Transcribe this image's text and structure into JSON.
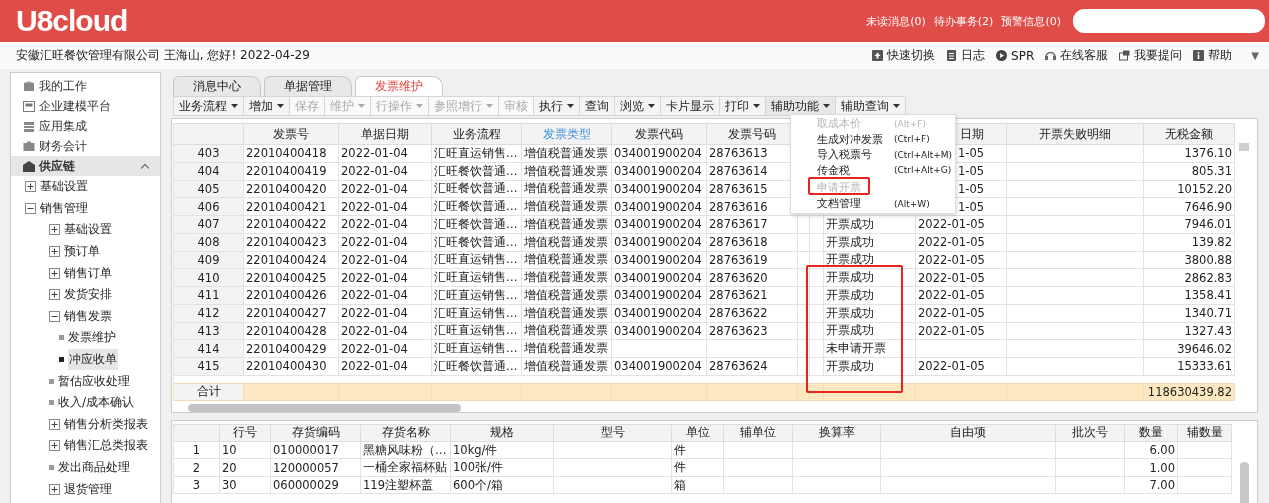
{
  "header": {
    "logo": "U8cloud",
    "links": [
      "未读消息(0)",
      "待办事务(2)",
      "预警信息(0)"
    ]
  },
  "infobar": {
    "greeting": "安徽汇旺餐饮管理有限公司 王海山, 您好! 2022-04-29",
    "tools": [
      "快速切换",
      "日志",
      "SPR",
      "在线客服",
      "我要提问",
      "帮助"
    ],
    "more": "▼"
  },
  "sidebar": {
    "items": [
      {
        "label": "我的工作",
        "kind": "module",
        "selected": false,
        "expanded": false
      },
      {
        "label": "企业建模平台",
        "kind": "module",
        "selected": false,
        "expanded": false
      },
      {
        "label": "应用集成",
        "kind": "module",
        "selected": false,
        "expanded": false
      },
      {
        "label": "财务会计",
        "kind": "module",
        "selected": false,
        "expanded": false
      },
      {
        "label": "供应链",
        "kind": "module",
        "selected": true,
        "expanded": true,
        "children": [
          {
            "label": "基础设置",
            "kind": "folder",
            "selected": false,
            "expanded": false
          },
          {
            "label": "销售管理",
            "kind": "folder",
            "selected": false,
            "expanded": true,
            "children": [
              {
                "label": "基础设置",
                "kind": "folder",
                "selected": false,
                "expanded": false
              },
              {
                "label": "预订单",
                "kind": "folder",
                "selected": false,
                "expanded": false
              },
              {
                "label": "销售订单",
                "kind": "folder",
                "selected": false,
                "expanded": false
              },
              {
                "label": "发货安排",
                "kind": "folder",
                "selected": false,
                "expanded": false
              },
              {
                "label": "销售发票",
                "kind": "folder",
                "selected": false,
                "expanded": true,
                "children": [
                  {
                    "label": "发票维护",
                    "kind": "leaf",
                    "selected": false
                  },
                  {
                    "label": "冲应收单",
                    "kind": "leaf",
                    "selected": true
                  }
                ]
              },
              {
                "label": "暂估应收处理",
                "kind": "leaf",
                "selected": false
              },
              {
                "label": "收入/成本确认",
                "kind": "leaf",
                "selected": false
              },
              {
                "label": "销售分析类报表",
                "kind": "folder",
                "selected": false,
                "expanded": false
              },
              {
                "label": "销售汇总类报表",
                "kind": "folder",
                "selected": false,
                "expanded": false
              },
              {
                "label": "发出商品处理",
                "kind": "leaf",
                "selected": false
              },
              {
                "label": "退货管理",
                "kind": "folder",
                "selected": false,
                "expanded": false
              }
            ]
          }
        ]
      }
    ]
  },
  "tabs": [
    {
      "label": "消息中心",
      "selected": false
    },
    {
      "label": "单据管理",
      "selected": false
    },
    {
      "label": "发票维护",
      "selected": true
    }
  ],
  "toolbar": [
    {
      "label": "业务流程",
      "dropdown": true,
      "disabled": false,
      "open": false
    },
    {
      "label": "增加",
      "dropdown": true,
      "disabled": false,
      "open": false
    },
    {
      "label": "保存",
      "dropdown": false,
      "disabled": true,
      "open": false
    },
    {
      "label": "维护",
      "dropdown": true,
      "disabled": true,
      "open": false
    },
    {
      "label": "行操作",
      "dropdown": true,
      "disabled": true,
      "open": false
    },
    {
      "label": "参照增行",
      "dropdown": true,
      "disabled": true,
      "open": false
    },
    {
      "label": "审核",
      "dropdown": false,
      "disabled": true,
      "open": false
    },
    {
      "label": "执行",
      "dropdown": true,
      "disabled": false,
      "open": false
    },
    {
      "label": "查询",
      "dropdown": false,
      "disabled": false,
      "open": false
    },
    {
      "label": "浏览",
      "dropdown": true,
      "disabled": false,
      "open": false
    },
    {
      "label": "卡片显示",
      "dropdown": false,
      "disabled": false,
      "open": false
    },
    {
      "label": "打印",
      "dropdown": true,
      "disabled": false,
      "open": false
    },
    {
      "label": "辅助功能",
      "dropdown": true,
      "disabled": false,
      "open": true
    },
    {
      "label": "辅助查询",
      "dropdown": true,
      "disabled": false,
      "open": false
    }
  ],
  "dropdown_menu": {
    "items": [
      {
        "label": "取成本价",
        "shortcut": "(Alt+F)",
        "disabled": true
      },
      {
        "label": "生成对冲发票",
        "shortcut": "(Ctrl+F)",
        "disabled": false
      },
      {
        "label": "导入税票号",
        "shortcut": "(Ctrl+Alt+M)",
        "disabled": false
      },
      {
        "label": "传金税",
        "shortcut": "(Ctrl+Alt+G)",
        "disabled": false
      },
      {
        "label": "申请开票",
        "disabled": true
      },
      {
        "label": "文档管理",
        "shortcut": "(Alt+W)",
        "disabled": false
      }
    ]
  },
  "invoice_table": {
    "columns": [
      null,
      {
        "label": "发票号",
        "highlighted": false
      },
      {
        "label": "单据日期",
        "highlighted": false
      },
      {
        "label": "业务流程",
        "highlighted": false
      },
      {
        "label": "发票类型",
        "highlighted": true
      },
      {
        "label": "发票代码",
        "highlighted": false
      },
      {
        "label": "发票号码",
        "highlighted": false
      },
      null,
      null,
      null,
      {
        "label": "日期",
        "highlighted": false
      },
      {
        "label": "开票失败明细",
        "highlighted": false
      },
      {
        "label": "无税金额",
        "highlighted": false
      }
    ],
    "rows": [
      {
        "row": "403",
        "invoice_no": "22010400418",
        "doc_date": "2022-01-04",
        "process": "汇旺直运销售…",
        "invoice_type": "增值税普通发票",
        "invoice_code": "034001900204",
        "invoice_number": "28763613",
        "column_11": "1-05",
        "amount": "1376.10"
      },
      {
        "row": "404",
        "invoice_no": "22010400419",
        "doc_date": "2022-01-04",
        "process": "汇旺餐饮普通…",
        "invoice_type": "增值税普通发票",
        "invoice_code": "034001900204",
        "invoice_number": "28763614",
        "column_11": "1-05",
        "amount": "805.31"
      },
      {
        "row": "405",
        "invoice_no": "22010400420",
        "doc_date": "2022-01-04",
        "process": "汇旺餐饮普通…",
        "invoice_type": "增值税普通发票",
        "invoice_code": "034001900204",
        "invoice_number": "28763615",
        "column_11": "1-05",
        "amount": "10152.20"
      },
      {
        "row": "406",
        "invoice_no": "22010400421",
        "doc_date": "2022-01-04",
        "process": "汇旺餐饮普通…",
        "invoice_type": "增值税普通发票",
        "invoice_code": "034001900204",
        "invoice_number": "28763616",
        "column_11": "1-05",
        "amount": "7646.90"
      },
      {
        "row": "407",
        "invoice_no": "22010400422",
        "doc_date": "2022-01-04",
        "process": "汇旺餐饮普通…",
        "invoice_type": "增值税普通发票",
        "invoice_code": "034001900204",
        "invoice_number": "28763617",
        "column_10": "开票成功",
        "column_11": "2022-01-05",
        "amount": "7946.01"
      },
      {
        "row": "408",
        "invoice_no": "22010400423",
        "doc_date": "2022-01-04",
        "process": "汇旺餐饮普通…",
        "invoice_type": "增值税普通发票",
        "invoice_code": "034001900204",
        "invoice_number": "28763618",
        "column_10": "开票成功",
        "column_11": "2022-01-05",
        "amount": "139.82"
      },
      {
        "row": "409",
        "invoice_no": "22010400424",
        "doc_date": "2022-01-04",
        "process": "汇旺直运销售…",
        "invoice_type": "增值税普通发票",
        "invoice_code": "034001900204",
        "invoice_number": "28763619",
        "column_10": "开票成功",
        "column_11": "2022-01-05",
        "amount": "3800.88"
      },
      {
        "row": "410",
        "invoice_no": "22010400425",
        "doc_date": "2022-01-04",
        "process": "汇旺直运销售…",
        "invoice_type": "增值税普通发票",
        "invoice_code": "034001900204",
        "invoice_number": "28763620",
        "column_10": "开票成功",
        "column_11": "2022-01-05",
        "amount": "2862.83"
      },
      {
        "row": "411",
        "invoice_no": "22010400426",
        "doc_date": "2022-01-04",
        "process": "汇旺直运销售…",
        "invoice_type": "增值税普通发票",
        "invoice_code": "034001900204",
        "invoice_number": "28763621",
        "column_10": "开票成功",
        "column_11": "2022-01-05",
        "amount": "1358.41"
      },
      {
        "row": "412",
        "invoice_no": "22010400427",
        "doc_date": "2022-01-04",
        "process": "汇旺直运销售…",
        "invoice_type": "增值税普通发票",
        "invoice_code": "034001900204",
        "invoice_number": "28763622",
        "column_10": "开票成功",
        "column_11": "2022-01-05",
        "amount": "1340.71"
      },
      {
        "row": "413",
        "invoice_no": "22010400428",
        "doc_date": "2022-01-04",
        "process": "汇旺直运销售…",
        "invoice_type": "增值税普通发票",
        "invoice_code": "034001900204",
        "invoice_number": "28763623",
        "column_10": "开票成功",
        "column_11": "2022-01-05",
        "amount": "1327.43"
      },
      {
        "row": "414",
        "invoice_no": "22010400429",
        "doc_date": "2022-01-04",
        "process": "汇旺直运销售…",
        "invoice_type": "增值税普通发票",
        "column_10": "未申请开票",
        "amount": "39646.02"
      },
      {
        "row": "415",
        "invoice_no": "22010400430",
        "doc_date": "2022-01-04",
        "process": "汇旺餐饮普通…",
        "invoice_type": "增值税普通发票",
        "invoice_code": "034001900204",
        "invoice_number": "28763624",
        "column_10": "开票成功",
        "column_11": "2022-01-05",
        "amount": "15333.61"
      }
    ],
    "footer": {
      "row": "合计",
      "amount": "118630439.82"
    }
  },
  "detail_table": {
    "columns": [
      null,
      {
        "label": "行号"
      },
      {
        "label": "存货编码"
      },
      {
        "label": "存货名称"
      },
      {
        "label": "规格"
      },
      {
        "label": "型号"
      },
      {
        "label": "单位"
      },
      {
        "label": "辅单位"
      },
      {
        "label": "换算率"
      },
      {
        "label": "自由项"
      },
      {
        "label": "批次号"
      },
      {
        "label": "数量"
      },
      {
        "label": "辅数量"
      }
    ],
    "rows": [
      {
        "row": "1",
        "line_no": "10",
        "item_code": "010000017",
        "item_name": "黑糖风味粉（…",
        "spec": "10kg/件",
        "unit": "件",
        "qty": "6.00"
      },
      {
        "row": "2",
        "line_no": "20",
        "item_code": "120000057",
        "item_name": "一桶全家福杯贴",
        "spec": "100张/件",
        "unit": "件",
        "qty": "1.00"
      },
      {
        "row": "3",
        "line_no": "30",
        "item_code": "060000029",
        "item_name": "119注塑杯盖",
        "spec": "600个/箱",
        "unit": "箱",
        "qty": "7.00"
      }
    ]
  }
}
